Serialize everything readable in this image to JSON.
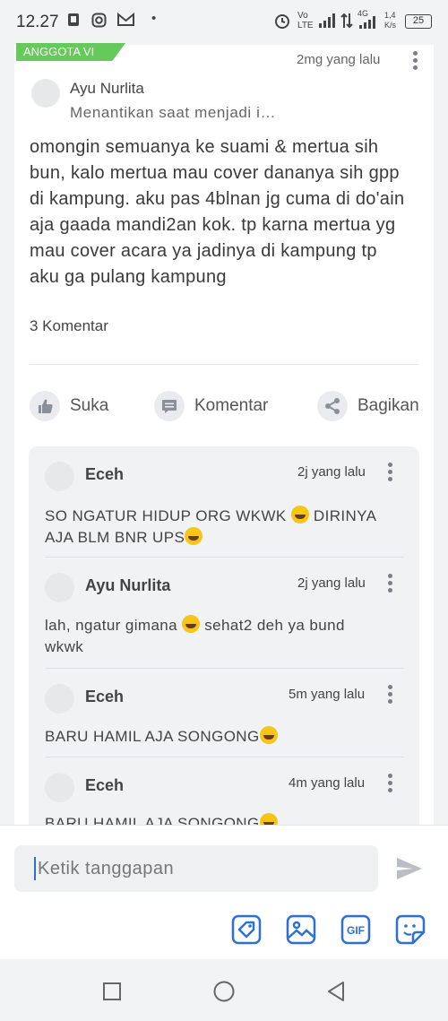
{
  "status_bar": {
    "time": "12.27",
    "dot": "•",
    "network": "Vo LTE",
    "net_type": "4G",
    "speed": "1,4 K/s",
    "battery": "25"
  },
  "post": {
    "badge": "ANGGOTA VI",
    "time": "2mg yang lalu",
    "author": {
      "name": "Ayu Nurlita",
      "status": "Menantikan saat menjadi i…"
    },
    "body": "omongin semuanya ke suami & mertua sih bun, kalo mertua mau cover dananya sih gpp di kampung. aku pas 4blnan jg cuma di do'ain aja gaada mandi2an kok. tp karna mertua yg mau cover acara ya jadinya di kampung tp aku ga pulang kampung",
    "comment_count": "3 Komentar",
    "actions": {
      "like": "Suka",
      "comment": "Komentar",
      "share": "Bagikan"
    }
  },
  "comments": [
    {
      "name": "Eceh",
      "time": "2j yang lalu",
      "text_a": "SO NGATUR HIDUP ORG WKWK",
      "text_b": " DIRINYA AJA BLM BNR UPS"
    },
    {
      "name": "Ayu Nurlita",
      "time": "2j yang lalu",
      "text_a": "lah, ngatur gimana",
      "text_b": "  sehat2 deh ya bund wkwk"
    },
    {
      "name": "Eceh",
      "time": "5m yang lalu",
      "text_a": "BARU HAMIL AJA SONGONG",
      "text_b": ""
    },
    {
      "name": "Eceh",
      "time": "4m yang lalu",
      "text_a": "BARU HAMIL AJA SONGONG",
      "text_b": ""
    }
  ],
  "composer": {
    "placeholder": "Ketik tanggapan",
    "tools": [
      "tag-icon",
      "image-icon",
      "gif-icon",
      "sticker-icon"
    ],
    "gif_label": "GIF"
  },
  "colors": {
    "accent": "#2e6fd6",
    "badge": "#66c95c",
    "card": "#ffffff",
    "background": "#f1f3f5"
  }
}
